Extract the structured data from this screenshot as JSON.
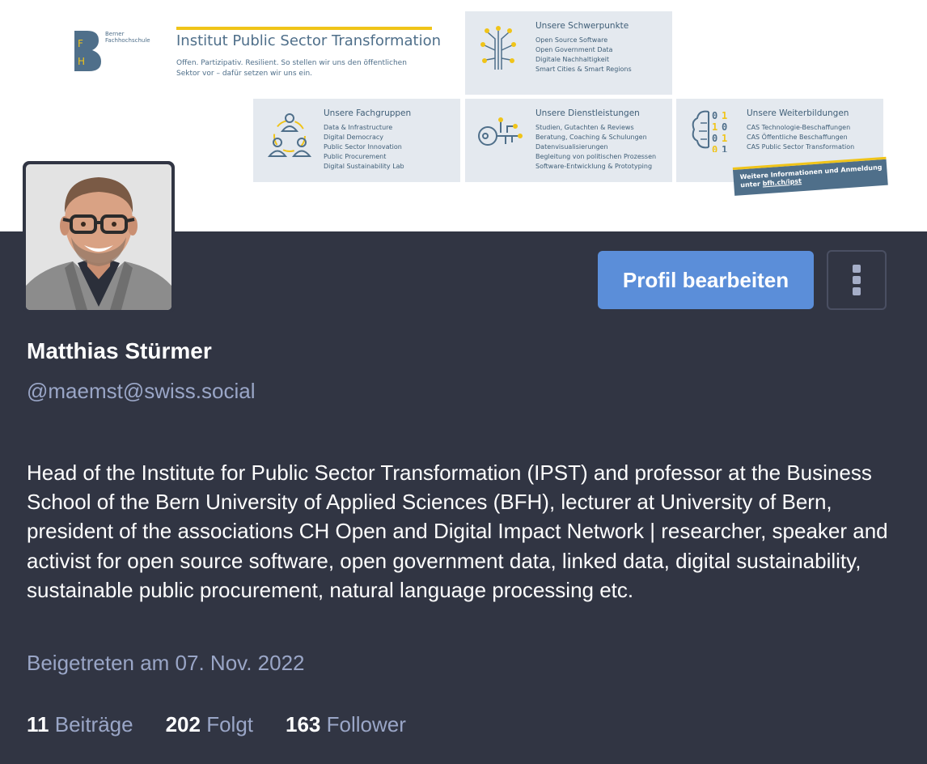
{
  "header_image": {
    "bfh_logo_text": "Berner Fachhochschule",
    "bfh_logo_letters": "FH",
    "institute_title": "Institut Public Sector Transformation",
    "institute_tagline": [
      "Offen. Partizipativ. Resilient. So stellen wir uns den öffentlichen",
      "Sektor vor – dafür setzen wir uns ein."
    ],
    "boxes": {
      "schwerpunkte": {
        "title": "Unsere Schwerpunkte",
        "lines": [
          "Open Source Software",
          "Open Government Data",
          "Digitale Nachhaltigkeit",
          "Smart Cities & Smart Regions"
        ]
      },
      "fachgruppen": {
        "title": "Unsere Fachgruppen",
        "lines": [
          "Data & Infrastructure",
          "Digital Democracy",
          "Public Sector Innovation",
          "Public Procurement",
          "Digital Sustainability Lab"
        ]
      },
      "dienstleistungen": {
        "title": "Unsere Dienstleistungen",
        "lines": [
          "Studien, Gutachten & Reviews",
          "Beratung, Coaching & Schulungen",
          "Datenvisualisierungen",
          "Begleitung von politischen Prozessen",
          "Software-Entwicklung & Prototyping"
        ]
      },
      "weiterbildungen": {
        "title": "Unsere Weiterbildungen",
        "lines": [
          "CAS Technologie-Beschaffungen",
          "CAS Öffentliche Beschaffungen",
          "CAS Public Sector Transformation"
        ]
      }
    },
    "cta_line1": "Weitere Informationen und Anmeldung",
    "cta_line2_prefix": "unter ",
    "cta_link": "bfh.ch/ipst"
  },
  "profile": {
    "display_name": "Matthias Stürmer",
    "handle": "@maemst@swiss.social",
    "bio": "Head of the Institute for Public Sector Transformation (IPST) and professor at the Business School of the Bern University of Applied Sciences (BFH), lecturer at University of Bern, president of the associations CH Open and Digital Impact Network | researcher, speaker and activist for open source software, open government data, linked data, digital sustainability, sustainable public procurement, natural language processing etc.",
    "joined": "Beigetreten am 07. Nov. 2022"
  },
  "actions": {
    "edit_label": "Profil bearbeiten",
    "more_icon": "vertical-ellipsis-icon"
  },
  "stats": {
    "posts": {
      "count": "11",
      "label": "Beiträge"
    },
    "following": {
      "count": "202",
      "label": "Folgt"
    },
    "followers": {
      "count": "163",
      "label": "Follower"
    }
  },
  "colors": {
    "background": "#313543",
    "accent": "#5b8ed9",
    "muted_text": "#9aa6c7",
    "banner_blue": "#4f6f8a",
    "banner_yellow": "#f0c419"
  }
}
